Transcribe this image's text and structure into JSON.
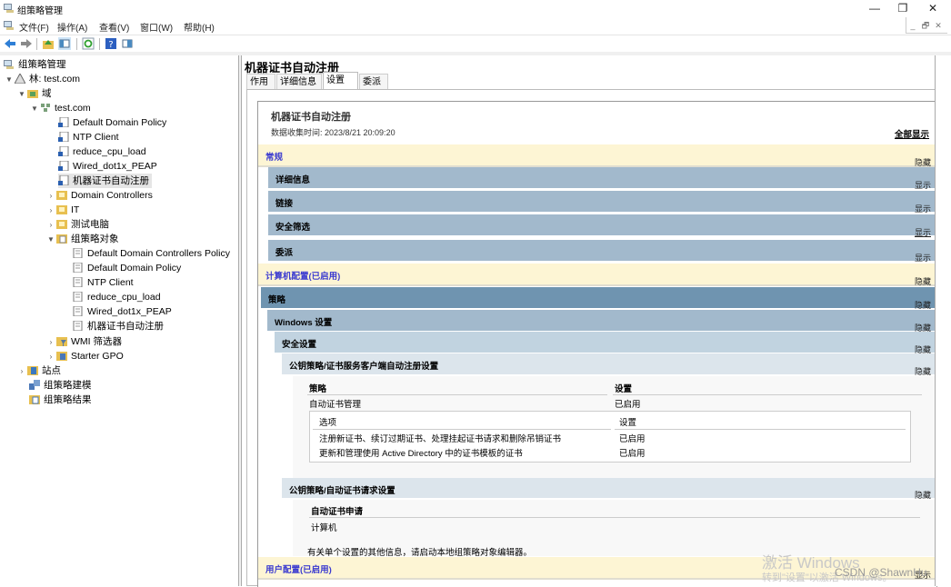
{
  "window": {
    "title": "组策略管理",
    "controls": {
      "minimize": "—",
      "maximize": "❐",
      "close": "✕"
    }
  },
  "menu": {
    "items": [
      "文件(F)",
      "操作(A)",
      "查看(V)",
      "窗口(W)",
      "帮助(H)"
    ],
    "mdi_controls": [
      "_",
      "🗗",
      "✕"
    ]
  },
  "toolbar": {
    "buttons": [
      "back-icon",
      "forward-icon",
      "up-folder-icon",
      "show-hide-tree-icon",
      "refresh-icon",
      "help-icon",
      "show-action-pane-icon"
    ]
  },
  "tree": {
    "root": "组策略管理",
    "forest": "林: test.com",
    "domains": "域",
    "domain": "test.com",
    "linked_gpos": [
      "Default Domain Policy",
      "NTP Client",
      "reduce_cpu_load",
      "Wired_dot1x_PEAP",
      "机器证书自动注册"
    ],
    "ous": [
      "Domain Controllers",
      "IT",
      "测试电脑"
    ],
    "gpo_container": "组策略对象",
    "gpos": [
      "Default Domain Controllers Policy",
      "Default Domain Policy",
      "NTP Client",
      "reduce_cpu_load",
      "Wired_dot1x_PEAP",
      "机器证书自动注册"
    ],
    "wmi": "WMI 筛选器",
    "starter": "Starter GPO",
    "sites": "站点",
    "modeling": "组策略建模",
    "results": "组策略结果",
    "selected": "机器证书自动注册"
  },
  "right": {
    "title": "机器证书自动注册",
    "tabs": [
      "作用域",
      "详细信息",
      "设置",
      "委派"
    ],
    "active_tab": "设置",
    "report": {
      "name": "机器证书自动注册",
      "collected": "数据收集时间: 2023/8/21 20:09:20",
      "show_all": "全部显示",
      "hide": "隐藏",
      "show": "显示",
      "general": "常规",
      "general_sections": [
        "详细信息",
        "链接",
        "安全筛选",
        "委派"
      ],
      "computer_config": "计算机配置(已启用)",
      "policies": "策略",
      "windows_settings": "Windows 设置",
      "security_settings": "安全设置",
      "pk_autoenroll": "公钥策略/证书服务客户端自动注册设置",
      "table1": {
        "headers": [
          "策略",
          "设置"
        ],
        "row": [
          "自动证书管理",
          "已启用"
        ],
        "inner_headers": [
          "选项",
          "设置"
        ],
        "inner_rows": [
          [
            "注册新证书、续订过期证书、处理挂起证书请求和删除吊销证书",
            "已启用"
          ],
          [
            "更新和管理使用 Active Directory 中的证书模板的证书",
            "已启用"
          ]
        ]
      },
      "pk_request": "公钥策略/自动证书请求设置",
      "table2": {
        "header": "自动证书申请",
        "row": "计算机"
      },
      "note": "有关单个设置的其他信息，请启动本地组策略对象编辑器。",
      "user_config": "用户配置(已启用)"
    }
  },
  "overlay": {
    "activate_line1": "激活 Windows",
    "activate_line2": "转到\"设置\"以激活 Windows。",
    "csdn": "CSDN @ShawnHu"
  },
  "colors": {
    "yellow_band": "#fdf5d4",
    "band_level1": "#6f94b0",
    "band_level2": "#a2b9cc",
    "band_level3": "#c1d3e0",
    "band_level4": "#dce5ec",
    "link_blue": "#3b3bd0"
  }
}
